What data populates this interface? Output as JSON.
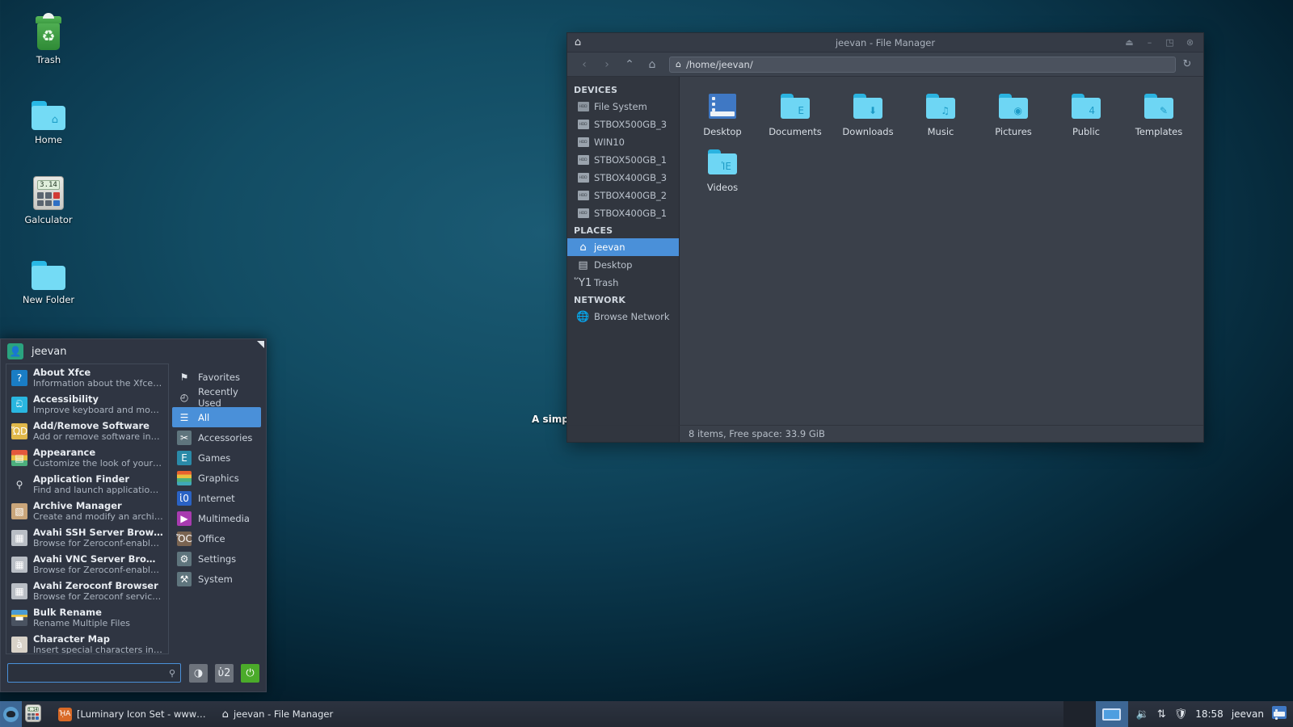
{
  "desktop": {
    "tooltip_text": "A simp",
    "icons": [
      {
        "label": "Trash",
        "icon": "trash-icon"
      },
      {
        "label": "Home",
        "icon": "home-folder-icon"
      },
      {
        "label": "Galculator",
        "icon": "calculator-icon",
        "display": "3.14"
      },
      {
        "label": "New Folder",
        "icon": "folder-icon"
      }
    ]
  },
  "file_manager": {
    "title": "jeevan - File Manager",
    "window_icon": "home-icon",
    "titlebar_buttons": [
      {
        "name": "shade-button",
        "glyph": "⏏"
      },
      {
        "name": "minimize-button",
        "glyph": "–"
      },
      {
        "name": "maximize-button",
        "glyph": "◳"
      },
      {
        "name": "close-button",
        "glyph": "⊗"
      }
    ],
    "toolbar": {
      "back": "‹",
      "forward": "›",
      "up": "⌃",
      "home": "⌂",
      "path": "/home/jeevan/",
      "reload": "↻"
    },
    "sidebar": {
      "devices_header": "DEVICES",
      "devices": [
        "File System",
        "STBOX500GB_3",
        "WIN10",
        "STBOX500GB_1",
        "STBOX400GB_3",
        "STBOX400GB_2",
        "STBOX400GB_1"
      ],
      "places_header": "PLACES",
      "places": [
        {
          "label": "jeevan",
          "icon": "home-icon",
          "selected": true
        },
        {
          "label": "Desktop",
          "icon": "desktop-icon",
          "selected": false
        },
        {
          "label": "Trash",
          "icon": "trash-icon",
          "selected": false
        }
      ],
      "network_header": "NETWORK",
      "network": [
        {
          "label": "Browse Network",
          "icon": "globe-icon"
        }
      ]
    },
    "items": [
      {
        "name": "Desktop",
        "icon": "desktop-folder-icon",
        "emblem": ""
      },
      {
        "name": "Documents",
        "icon": "folder-icon",
        "emblem": "὜E"
      },
      {
        "name": "Downloads",
        "icon": "folder-icon",
        "emblem": "⬇"
      },
      {
        "name": "Music",
        "icon": "folder-icon",
        "emblem": "♫"
      },
      {
        "name": "Pictures",
        "icon": "folder-icon",
        "emblem": "◉"
      },
      {
        "name": "Public",
        "icon": "folder-icon",
        "emblem": "὆4"
      },
      {
        "name": "Templates",
        "icon": "folder-icon",
        "emblem": "✎"
      },
      {
        "name": "Videos",
        "icon": "folder-icon",
        "emblem": "ἹE"
      }
    ],
    "status": "8 items, Free space: 33.9 GiB"
  },
  "whisker_menu": {
    "username": "jeevan",
    "avatar_icon": "user-icon",
    "applications": [
      {
        "title": "About Xfce",
        "desc": "Information about the Xfce Deskto…",
        "icon": "help-icon",
        "color": "#1a7dc4",
        "glyph": "?"
      },
      {
        "title": "Accessibility",
        "desc": "Improve keyboard and mouse acces…",
        "icon": "accessibility-icon",
        "color": "#29b6e0",
        "glyph": "ඞ"
      },
      {
        "title": "Add/Remove Software",
        "desc": "Add or remove software installed o…",
        "icon": "software-bag-icon",
        "color": "#e0b84a",
        "glyph": "ὬD"
      },
      {
        "title": "Appearance",
        "desc": "Customize the look of your desktop",
        "icon": "appearance-icon",
        "color": "#e4593c",
        "glyph": "▤"
      },
      {
        "title": "Application Finder",
        "desc": "Find and launch applications install…",
        "icon": "search-icon",
        "color": "transparent",
        "glyph": "⚲"
      },
      {
        "title": "Archive Manager",
        "desc": "Create and modify an archive",
        "icon": "archive-box-icon",
        "color": "#c9a57a",
        "glyph": "▧"
      },
      {
        "title": "Avahi SSH Server Browser",
        "desc": "Browse for Zeroconf-enabled SSH …",
        "icon": "network-jack-icon",
        "color": "#b9bec5",
        "glyph": "▦"
      },
      {
        "title": "Avahi VNC Server Browser",
        "desc": "Browse for Zeroconf-enabled VNC…",
        "icon": "network-jack-icon",
        "color": "#b9bec5",
        "glyph": "▦"
      },
      {
        "title": "Avahi Zeroconf Browser",
        "desc": "Browse for Zeroconf services availa…",
        "icon": "network-jack-icon",
        "color": "#b9bec5",
        "glyph": "▦"
      },
      {
        "title": "Bulk Rename",
        "desc": "Rename Multiple Files",
        "icon": "bulk-rename-icon",
        "color": "#4a5361",
        "glyph": "▬"
      },
      {
        "title": "Character Map",
        "desc": "Insert special characters into docu…",
        "icon": "character-map-icon",
        "color": "#d8d2c8",
        "glyph": "à"
      }
    ],
    "categories": [
      {
        "label": "Favorites",
        "icon": "bookmark-icon",
        "glyph": "⚑",
        "color": "transparent",
        "selected": false
      },
      {
        "label": "Recently Used",
        "icon": "clock-icon",
        "glyph": "◴",
        "color": "transparent",
        "selected": false
      },
      {
        "label": "All",
        "icon": "list-icon",
        "glyph": "☰",
        "color": "transparent",
        "selected": true
      },
      {
        "label": "Accessories",
        "icon": "scissors-icon",
        "glyph": "✂",
        "color": "#5f757d",
        "selected": false
      },
      {
        "label": "Games",
        "icon": "gamepad-icon",
        "glyph": "὇E",
        "color": "#2a8aa8",
        "selected": false
      },
      {
        "label": "Graphics",
        "icon": "graphics-icon",
        "glyph": "",
        "color": "#e8c040",
        "selected": false
      },
      {
        "label": "Internet",
        "icon": "globe-icon",
        "glyph": "ἱ0",
        "color": "#2a62c4",
        "selected": false
      },
      {
        "label": "Multimedia",
        "icon": "film-icon",
        "glyph": "▶",
        "color": "#a83bb0",
        "selected": false
      },
      {
        "label": "Office",
        "icon": "pushpin-icon",
        "glyph": "ὌC",
        "color": "#7a6451",
        "selected": false
      },
      {
        "label": "Settings",
        "icon": "sliders-icon",
        "glyph": "⚙",
        "color": "#5f757d",
        "selected": false
      },
      {
        "label": "System",
        "icon": "system-icon",
        "glyph": "⚒",
        "color": "#5f757d",
        "selected": false
      }
    ],
    "search": {
      "value": "",
      "placeholder": "",
      "icon": "search-icon"
    },
    "footer_buttons": [
      {
        "name": "settings-button",
        "glyph": "◑",
        "color": "#8d939c"
      },
      {
        "name": "lock-button",
        "glyph": "ὑ2",
        "color": "#6d737c"
      },
      {
        "name": "logout-button",
        "glyph": "⏻",
        "color": "#4bab2a"
      }
    ]
  },
  "taskbar": {
    "launchers": [
      {
        "name": "whisker-menu-button",
        "icon": "xfce-mouse-icon"
      },
      {
        "name": "calculator-launcher",
        "icon": "calculator-icon"
      }
    ],
    "tasks": [
      {
        "label": "[Luminary Icon Set - www…",
        "icon": "firefox-icon"
      },
      {
        "label": "jeevan - File Manager",
        "icon": "home-icon"
      }
    ],
    "tray": {
      "volume_icon": "speaker-icon",
      "network_icon": "network-updown-icon",
      "security_icon": "shield-icon",
      "clock": "18:58",
      "user": "jeevan",
      "desktop_icon": "show-desktop-icon"
    },
    "workspaces": [
      {
        "name": "workspace-1",
        "active": false
      },
      {
        "name": "workspace-2",
        "active": true
      }
    ]
  },
  "colors": {
    "accent": "#4a90d9",
    "panel_bg": "#2f3542",
    "window_bg": "#31363f",
    "folder": "#6ed6f4",
    "desktop": "#0c3b51"
  }
}
